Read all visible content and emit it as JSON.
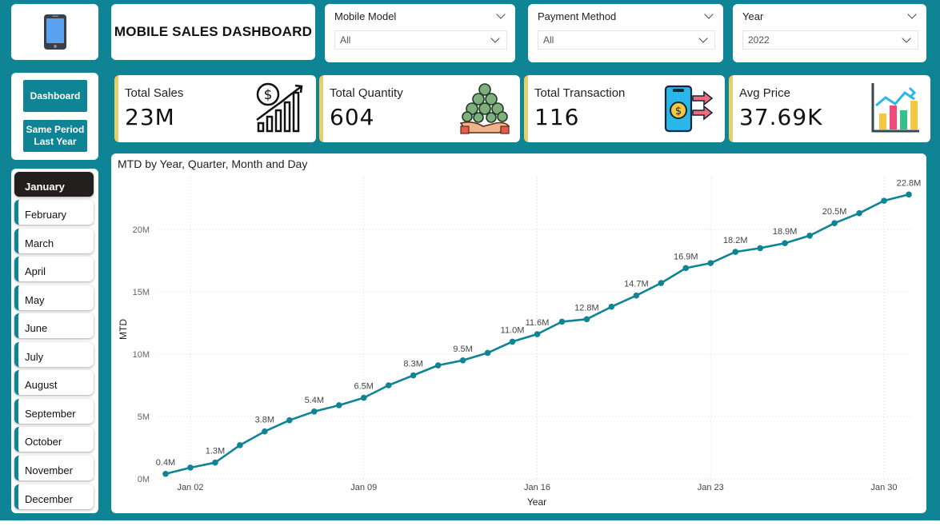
{
  "header": {
    "title": "MOBILE SALES DASHBOARD",
    "logo_icon": "smartphone-icon"
  },
  "filters": [
    {
      "label": "Mobile Model",
      "value": "All"
    },
    {
      "label": "Payment Method",
      "value": "All"
    },
    {
      "label": "Year",
      "value": "2022"
    }
  ],
  "nav": {
    "dashboard": "Dashboard",
    "same_period_line1": "Same Period",
    "same_period_line2": "Last Year"
  },
  "months": [
    "January",
    "February",
    "March",
    "April",
    "May",
    "June",
    "July",
    "August",
    "September",
    "October",
    "November",
    "December"
  ],
  "active_month": "January",
  "kpis": [
    {
      "label": "Total Sales",
      "value": "23M",
      "icon": "sales-growth-icon"
    },
    {
      "label": "Total Quantity",
      "value": "604",
      "icon": "coins-hand-icon"
    },
    {
      "label": "Total Transaction",
      "value": "116",
      "icon": "mobile-payment-icon"
    },
    {
      "label": "Avg Price",
      "value": "37.69K",
      "icon": "bar-chart-icon"
    }
  ],
  "colors": {
    "accent": "#0e8494",
    "kpi_bar": "#e8d064",
    "active_month": "#231f1f"
  },
  "chart_data": {
    "type": "line",
    "title": "MTD by Year, Quarter, Month and Day",
    "xlabel": "Year",
    "ylabel": "MTD",
    "x_ticks": [
      "Jan 02",
      "Jan 09",
      "Jan 16",
      "Jan 23",
      "Jan 30"
    ],
    "y_ticks": [
      "0M",
      "5M",
      "10M",
      "15M",
      "20M"
    ],
    "ylim": [
      0,
      24
    ],
    "grid": true,
    "x": [
      1,
      2,
      3,
      4,
      5,
      6,
      7,
      8,
      9,
      10,
      11,
      12,
      13,
      14,
      15,
      16,
      17,
      18,
      19,
      20,
      21,
      22,
      23,
      24,
      25,
      26,
      27,
      28,
      29,
      30,
      31
    ],
    "values": [
      0.4,
      0.9,
      1.3,
      2.7,
      3.8,
      4.7,
      5.4,
      5.9,
      6.5,
      7.5,
      8.3,
      9.1,
      9.5,
      10.1,
      11.0,
      11.6,
      12.6,
      12.8,
      13.8,
      14.7,
      15.7,
      16.9,
      17.3,
      18.2,
      18.5,
      18.9,
      19.5,
      20.5,
      21.3,
      22.3,
      22.8
    ],
    "point_labels": [
      "0.4M",
      "",
      "1.3M",
      "",
      "3.8M",
      "",
      "5.4M",
      "",
      "6.5M",
      "",
      "8.3M",
      "",
      "9.5M",
      "",
      "11.0M",
      "11.6M",
      "",
      "12.8M",
      "",
      "14.7M",
      "",
      "16.9M",
      "",
      "18.2M",
      "",
      "18.9M",
      "",
      "20.5M",
      "",
      "",
      "22.8M"
    ]
  }
}
